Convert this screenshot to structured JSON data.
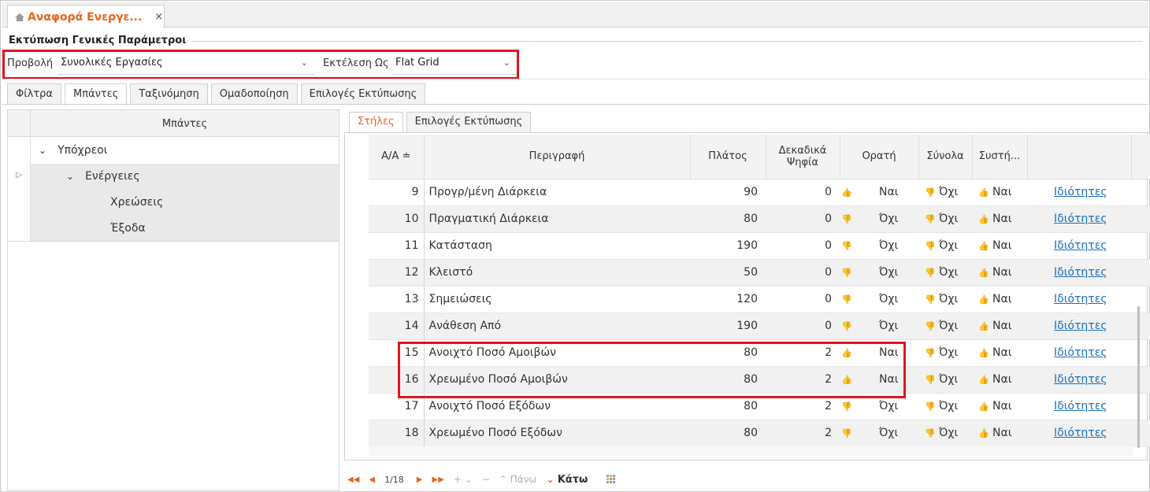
{
  "doc_tab": {
    "title": "Αναφορά Ενεργε...",
    "close": "×"
  },
  "section_title": "Εκτύπωση Γενικές Παράμετροι",
  "params": {
    "view_label": "Προβολή",
    "view_value": "Συνολικές Εργασίες",
    "exec_label": "Εκτέλεση Ως",
    "exec_value": "Flat Grid"
  },
  "outer_tabs": [
    "Φίλτρα",
    "Μπάντες",
    "Ταξινόμηση",
    "Ομαδοποίηση",
    "Επιλογές Εκτύπωσης"
  ],
  "outer_active": "Μπάντες",
  "tree": {
    "header": "Μπάντες",
    "items": [
      {
        "label": "Υπόχρεοι",
        "expander": "⌄",
        "indent": 1
      },
      {
        "label": "Ενέργειες",
        "expander": "⌄",
        "indent": 2,
        "gutter": "▷"
      },
      {
        "label": "Χρεώσεις",
        "indent": 3
      },
      {
        "label": "Έξοδα",
        "indent": 3
      }
    ]
  },
  "inner_tabs": [
    "Στήλες",
    "Επιλογές Εκτύπωσης"
  ],
  "inner_active": "Στήλες",
  "grid": {
    "headers": {
      "num": "Α/Α",
      "sort_icon": "≐",
      "desc": "Περιγραφή",
      "width": "Πλάτος",
      "decimals_1": "Δεκαδικά",
      "decimals_2": "Ψηφία",
      "visible": "Ορατή",
      "totals": "Σύνολα",
      "system": "Συστή..."
    },
    "rows": [
      {
        "n": "9",
        "desc": "Προγρ/μένη Διάρκεια",
        "w": "90",
        "d": "0",
        "vis": "Ναι",
        "tot": "Όχι",
        "sys": "Ναι",
        "link": "Ιδιότητες"
      },
      {
        "n": "10",
        "desc": "Πραγματική Διάρκεια",
        "w": "80",
        "d": "0",
        "vis": "Όχι",
        "tot": "Όχι",
        "sys": "Ναι",
        "link": "Ιδιότητες"
      },
      {
        "n": "11",
        "desc": "Κατάσταση",
        "w": "190",
        "d": "0",
        "vis": "Όχι",
        "tot": "Όχι",
        "sys": "Ναι",
        "link": "Ιδιότητες"
      },
      {
        "n": "12",
        "desc": "Κλειστό",
        "w": "50",
        "d": "0",
        "vis": "Όχι",
        "tot": "Όχι",
        "sys": "Ναι",
        "link": "Ιδιότητες"
      },
      {
        "n": "13",
        "desc": "Σημειώσεις",
        "w": "120",
        "d": "0",
        "vis": "Όχι",
        "tot": "Όχι",
        "sys": "Ναι",
        "link": "Ιδιότητες"
      },
      {
        "n": "14",
        "desc": "Ανάθεση Από",
        "w": "190",
        "d": "0",
        "vis": "Όχι",
        "tot": "Όχι",
        "sys": "Ναι",
        "link": "Ιδιότητες"
      },
      {
        "n": "15",
        "desc": "Ανοιχτό Ποσό Αμοιβών",
        "w": "80",
        "d": "2",
        "vis": "Ναι",
        "tot": "Όχι",
        "sys": "Ναι",
        "link": "Ιδιότητες"
      },
      {
        "n": "16",
        "desc": "Χρεωμένο Ποσό Αμοιβών",
        "w": "80",
        "d": "2",
        "vis": "Ναι",
        "tot": "Όχι",
        "sys": "Ναι",
        "link": "Ιδιότητες"
      },
      {
        "n": "17",
        "desc": "Ανοιχτό Ποσό Εξόδων",
        "w": "80",
        "d": "2",
        "vis": "Όχι",
        "tot": "Όχι",
        "sys": "Ναι",
        "link": "Ιδιότητες"
      },
      {
        "n": "18",
        "desc": "Χρεωμένο Ποσό Εξόδων",
        "w": "80",
        "d": "2",
        "vis": "Όχι",
        "tot": "Όχι",
        "sys": "Ναι",
        "link": "Ιδιότητες"
      }
    ]
  },
  "pager": {
    "first": "◀◀",
    "prev": "◀",
    "position": "1/18",
    "next": "▶",
    "last": "▶▶",
    "add": "+ ⌄",
    "remove": "−",
    "up_label": "Πάνω",
    "down_label": "Κάτω"
  },
  "colors": {
    "accent": "#e8641b",
    "highlight": "#e0141e",
    "link": "#1a6fc2",
    "thumb_up": "#6f9e6e",
    "thumb_down": "#e55a2b"
  },
  "icons": {
    "yes": "thumbs-up-icon",
    "no": "thumbs-down-icon",
    "home": "home-icon",
    "grid": "grid-settings-icon"
  }
}
